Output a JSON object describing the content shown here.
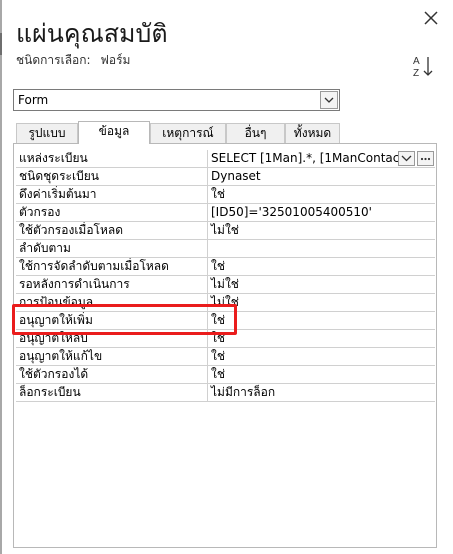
{
  "panel": {
    "title": "แผ่นคุณสมบัติ",
    "selection_type_label": "ชนิดการเลือก:",
    "selection_type_value": "ฟอร์ม",
    "sort_icon": "sort-a-z-icon",
    "close_icon": "close-icon"
  },
  "object_selector": {
    "value": "Form"
  },
  "tabs": [
    {
      "label": "รูปแบบ",
      "active": false
    },
    {
      "label": "ข้อมูล",
      "active": true
    },
    {
      "label": "เหตุการณ์",
      "active": false
    },
    {
      "label": "อื่นๆ",
      "active": false
    },
    {
      "label": "ทั้งหมด",
      "active": false
    }
  ],
  "properties": [
    {
      "label": "แหล่งระเบียน",
      "value": "SELECT [1Man].*, [1ManContac"
    },
    {
      "label": "ชนิดชุดระเบียน",
      "value": "Dynaset"
    },
    {
      "label": "ดึงค่าเริ่มต้นมา",
      "value": "ใช่"
    },
    {
      "label": "ตัวกรอง",
      "value": "[ID50]='32501005400510'"
    },
    {
      "label": "ใช้ตัวกรองเมื่อโหลด",
      "value": "ไม่ใช่"
    },
    {
      "label": "ลำดับตาม",
      "value": ""
    },
    {
      "label": "ใช้การจัดลำดับตามเมื่อโหลด",
      "value": "ใช่"
    },
    {
      "label": "รอหลังการดำเนินการ",
      "value": "ไม่ใช่"
    },
    {
      "label": "การป้อนข้อมูล",
      "value": "ไม่ใช่"
    },
    {
      "label": "อนุญาตให้เพิ่ม",
      "value": "ใช่"
    },
    {
      "label": "อนุญาตให้ลบ",
      "value": "ใช่"
    },
    {
      "label": "อนุญาตให้แก้ไข",
      "value": "ใช่"
    },
    {
      "label": "ใช้ตัวกรองได้",
      "value": "ใช่"
    },
    {
      "label": "ล็อกระเบียน",
      "value": "ไม่มีการล็อก"
    }
  ],
  "highlight_color": "#ea1c1c"
}
